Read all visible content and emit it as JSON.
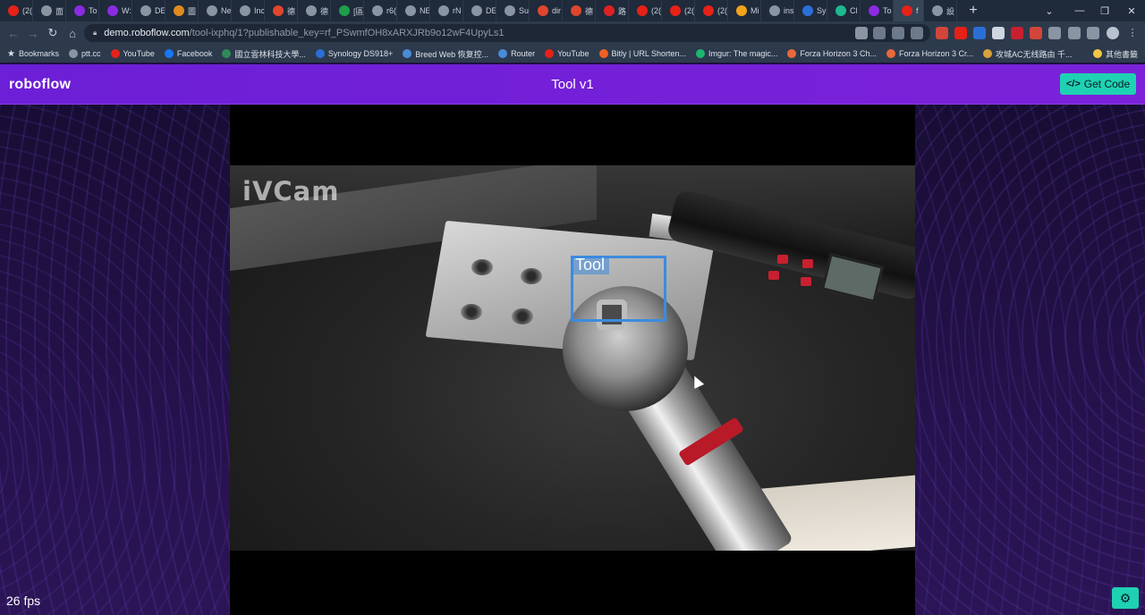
{
  "browser": {
    "tabs": [
      {
        "icon": "youtube-icon",
        "text": "(2(",
        "color": "#e62117"
      },
      {
        "icon": "globe-icon",
        "text": "面",
        "color": "#8a95a3"
      },
      {
        "icon": "roboflow-icon",
        "text": "To",
        "color": "#8a2be2"
      },
      {
        "icon": "roboflow-icon",
        "text": "W:",
        "color": "#8a2be2"
      },
      {
        "icon": "puzzle-icon",
        "text": "DE",
        "color": "#8a95a3"
      },
      {
        "icon": "image-icon",
        "text": "圖",
        "color": "#e08a1e"
      },
      {
        "icon": "puzzle-icon",
        "text": "Ne",
        "color": "#8a95a3"
      },
      {
        "icon": "globe-icon",
        "text": "Inc",
        "color": "#8a95a3"
      },
      {
        "icon": "c-icon",
        "text": "德",
        "color": "#e0452e"
      },
      {
        "icon": "globe-icon",
        "text": "德",
        "color": "#8a95a3"
      },
      {
        "icon": "sheet-icon",
        "text": "[區",
        "color": "#1e9e4a"
      },
      {
        "icon": "google-icon",
        "text": "r6(",
        "color": "#8a95a3"
      },
      {
        "icon": "google-icon",
        "text": "NE",
        "color": "#8a95a3"
      },
      {
        "icon": "google-icon",
        "text": "rN",
        "color": "#8a95a3"
      },
      {
        "icon": "puzzle-icon",
        "text": "DE",
        "color": "#8a95a3"
      },
      {
        "icon": "puzzle-icon",
        "text": "Su",
        "color": "#8a95a3"
      },
      {
        "icon": "c-icon",
        "text": "dir",
        "color": "#e0452e"
      },
      {
        "icon": "c-icon",
        "text": "德",
        "color": "#e0452e"
      },
      {
        "icon": "jd-icon",
        "text": "路",
        "color": "#d22"
      },
      {
        "icon": "youtube-icon",
        "text": "(2(",
        "color": "#e62117"
      },
      {
        "icon": "youtube-icon",
        "text": "(2(",
        "color": "#e62117"
      },
      {
        "icon": "youtube-icon",
        "text": "(2(",
        "color": "#e62117"
      },
      {
        "icon": "chart-icon",
        "text": "Mi",
        "color": "#f2a31b"
      },
      {
        "icon": "google-icon",
        "text": "ins",
        "color": "#8a95a3"
      },
      {
        "icon": "synology-icon",
        "text": "Sy",
        "color": "#2a6fd6"
      },
      {
        "icon": "c-icon",
        "text": "Cl",
        "color": "#1eb88f"
      },
      {
        "icon": "roboflow-icon",
        "text": "To",
        "color": "#8a2be2"
      },
      {
        "icon": "recording-icon",
        "text": "f",
        "color": "#e62117",
        "active": true,
        "close": "×"
      },
      {
        "icon": "gear-icon",
        "text": "設",
        "color": "#8a95a3"
      }
    ],
    "new_tab": "+",
    "url_host": "demo.roboflow.com",
    "url_path": "/tool-ixphq/1?publishable_key=rf_PSwmfOH8xARXJRb9o12wF4UpyLs1",
    "bookmarks": [
      {
        "icon": "star-icon",
        "label": "Bookmarks"
      },
      {
        "icon": "ptt-icon",
        "label": "ptt.cc",
        "color": "#8a95a3"
      },
      {
        "icon": "youtube-icon",
        "label": "YouTube",
        "color": "#e62117"
      },
      {
        "icon": "facebook-icon",
        "label": "Facebook",
        "color": "#1877f2"
      },
      {
        "icon": "university-icon",
        "label": "國立雲林科技大學...",
        "color": "#2e8b57"
      },
      {
        "icon": "synology-icon",
        "label": "Synology DS918+",
        "color": "#2a6fd6"
      },
      {
        "icon": "breed-icon",
        "label": "Breed Web 恢复控...",
        "color": "#4a8bd6"
      },
      {
        "icon": "router-icon",
        "label": "Router",
        "color": "#4a8bd6"
      },
      {
        "icon": "youtube-icon",
        "label": "YouTube",
        "color": "#e62117"
      },
      {
        "icon": "bitly-icon",
        "label": "Bitly | URL Shorten...",
        "color": "#ee6123"
      },
      {
        "icon": "imgur-icon",
        "label": "Imgur: The magic...",
        "color": "#1bb76e"
      },
      {
        "icon": "forza-icon",
        "label": "Forza Horizon 3 Ch...",
        "color": "#e8693a"
      },
      {
        "icon": "forza-icon",
        "label": "Forza Horizon 3 Cr...",
        "color": "#e8693a"
      },
      {
        "icon": "router-icon",
        "label": "攻城AC无线路由 千...",
        "color": "#d9a23a"
      },
      {
        "icon": "folder-icon",
        "label": "其他書籤",
        "color": "#f2c744"
      }
    ]
  },
  "app": {
    "logo": "roboflow",
    "title": "Tool v1",
    "get_code_icon": "</>",
    "get_code_label": "Get Code",
    "brand_color": "#7b22d9",
    "accent_color": "#1fd1b3"
  },
  "video": {
    "watermark": "iVCam",
    "detections": [
      {
        "label": "Tool",
        "color": "#3c8bdf"
      }
    ]
  },
  "footer": {
    "fps": "26 fps",
    "settings_icon": "⚙"
  }
}
